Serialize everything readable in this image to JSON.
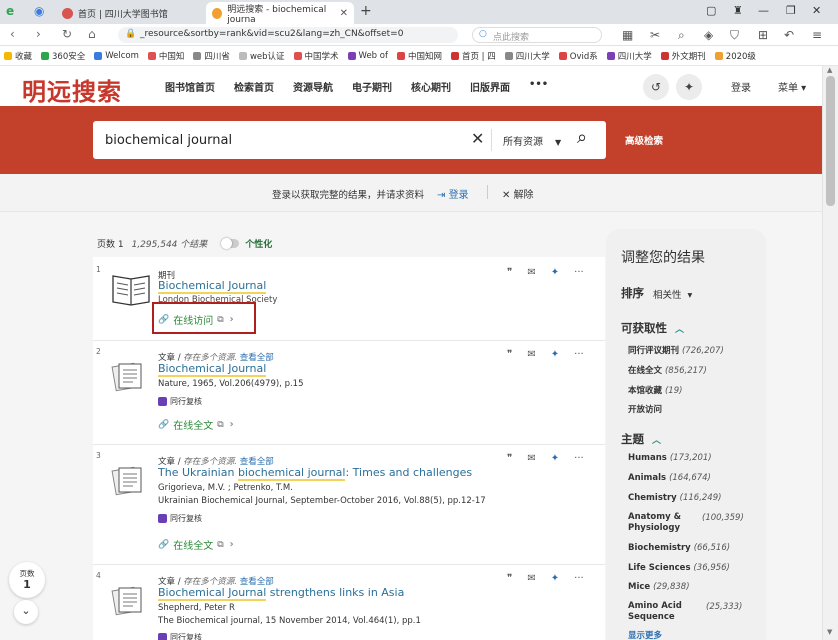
{
  "browser": {
    "tabs": [
      {
        "label": "首页 | 四川大学图书馆",
        "active": false
      },
      {
        "label": "明远搜索 - biochemical journa",
        "active": true
      }
    ],
    "url": "_resource&sortby=rank&vid=scu2&lang=zh_CN&offset=0",
    "search_placeholder": "点此搜索",
    "bookmarks": [
      "收藏",
      "360安全",
      "Welcom",
      "中国知",
      "四川省",
      "web认证",
      "中国学术",
      "Web of",
      "中国知网",
      "首页 | 四",
      "四川大学",
      "Ovid系",
      "四川大学",
      "外文期刊",
      "2020级"
    ]
  },
  "site": {
    "logo": "明远搜索",
    "nav": [
      "图书馆首页",
      "检索首页",
      "资源导航",
      "电子期刊",
      "核心期刊",
      "旧版界面",
      "•••"
    ],
    "login": "登录",
    "menu": "菜单",
    "search": {
      "value": "biochemical journal",
      "scope": "所有资源",
      "advanced": "高级检索"
    },
    "notice": {
      "text": "登录以获取完整的结果，并请求资料",
      "login": "登录",
      "dismiss": "解除"
    }
  },
  "results_bar": {
    "page_label": "页数 1",
    "count": "1,295,544 个结果",
    "personalize": "个性化"
  },
  "results": [
    {
      "num": "1",
      "type": "期刊",
      "title_hl": "Biochemical Journal",
      "title_rest": "",
      "publisher": "London Biochemical Society",
      "access": "在线访问"
    },
    {
      "num": "2",
      "type": "文章",
      "src": "存在多个资源.",
      "src_link": "查看全部",
      "title_hl": "Biochemical Journal",
      "title_rest": "",
      "meta": "Nature, 1965, Vol.206(4979), p.15",
      "peer": "同行复核",
      "access": "在线全文"
    },
    {
      "num": "3",
      "type": "文章",
      "src": "存在多个资源.",
      "src_link": "查看全部",
      "title_pre": "The Ukrainian ",
      "title_hl": "biochemical journal",
      "title_rest": ": Times and challenges",
      "authors": "Grigorieva, M.V. ; Petrenko, T.M.",
      "meta": "Ukrainian Biochemical Journal, September-October 2016, Vol.88(5), pp.12-17",
      "peer": "同行复核",
      "access": "在线全文"
    },
    {
      "num": "4",
      "type": "文章",
      "src": "存在多个资源.",
      "src_link": "查看全部",
      "title_hl": "Biochemical Journal",
      "title_rest": " strengthens links in Asia",
      "authors": "Shepherd, Peter R",
      "meta": "The Biochemical journal, 15 November 2014, Vol.464(1), pp.1",
      "peer": "同行复核"
    }
  ],
  "facets": {
    "title": "调整您的结果",
    "sort_label": "排序",
    "sort_value": "相关性",
    "availability": {
      "label": "可获取性",
      "items": [
        {
          "name": "同行评议期刊",
          "count": "(726,207)"
        },
        {
          "name": "在线全文",
          "count": "(856,217)"
        },
        {
          "name": "本馆收藏",
          "count": "(19)"
        },
        {
          "name": "开放访问",
          "count": ""
        }
      ]
    },
    "subject": {
      "label": "主题",
      "items": [
        {
          "name": "Humans",
          "count": "(173,201)"
        },
        {
          "name": "Animals",
          "count": "(164,674)"
        },
        {
          "name": "Chemistry",
          "count": "(116,249)"
        },
        {
          "name": "Anatomy & Physiology",
          "count": "(100,359)"
        },
        {
          "name": "Biochemistry",
          "count": "(66,516)"
        },
        {
          "name": "Life Sciences",
          "count": "(36,956)"
        },
        {
          "name": "Mice",
          "count": "(29,838)"
        },
        {
          "name": "Amino Acid Sequence",
          "count": "(25,333)"
        }
      ],
      "more": "显示更多"
    }
  },
  "page_widget": {
    "label": "页数",
    "value": "1"
  },
  "colors": {
    "brand_red": "#c3402a",
    "link": "#2a6f9a",
    "access_green": "#2e8b3a",
    "highlight": "#f2d45c",
    "box_red": "#b01e1e"
  }
}
